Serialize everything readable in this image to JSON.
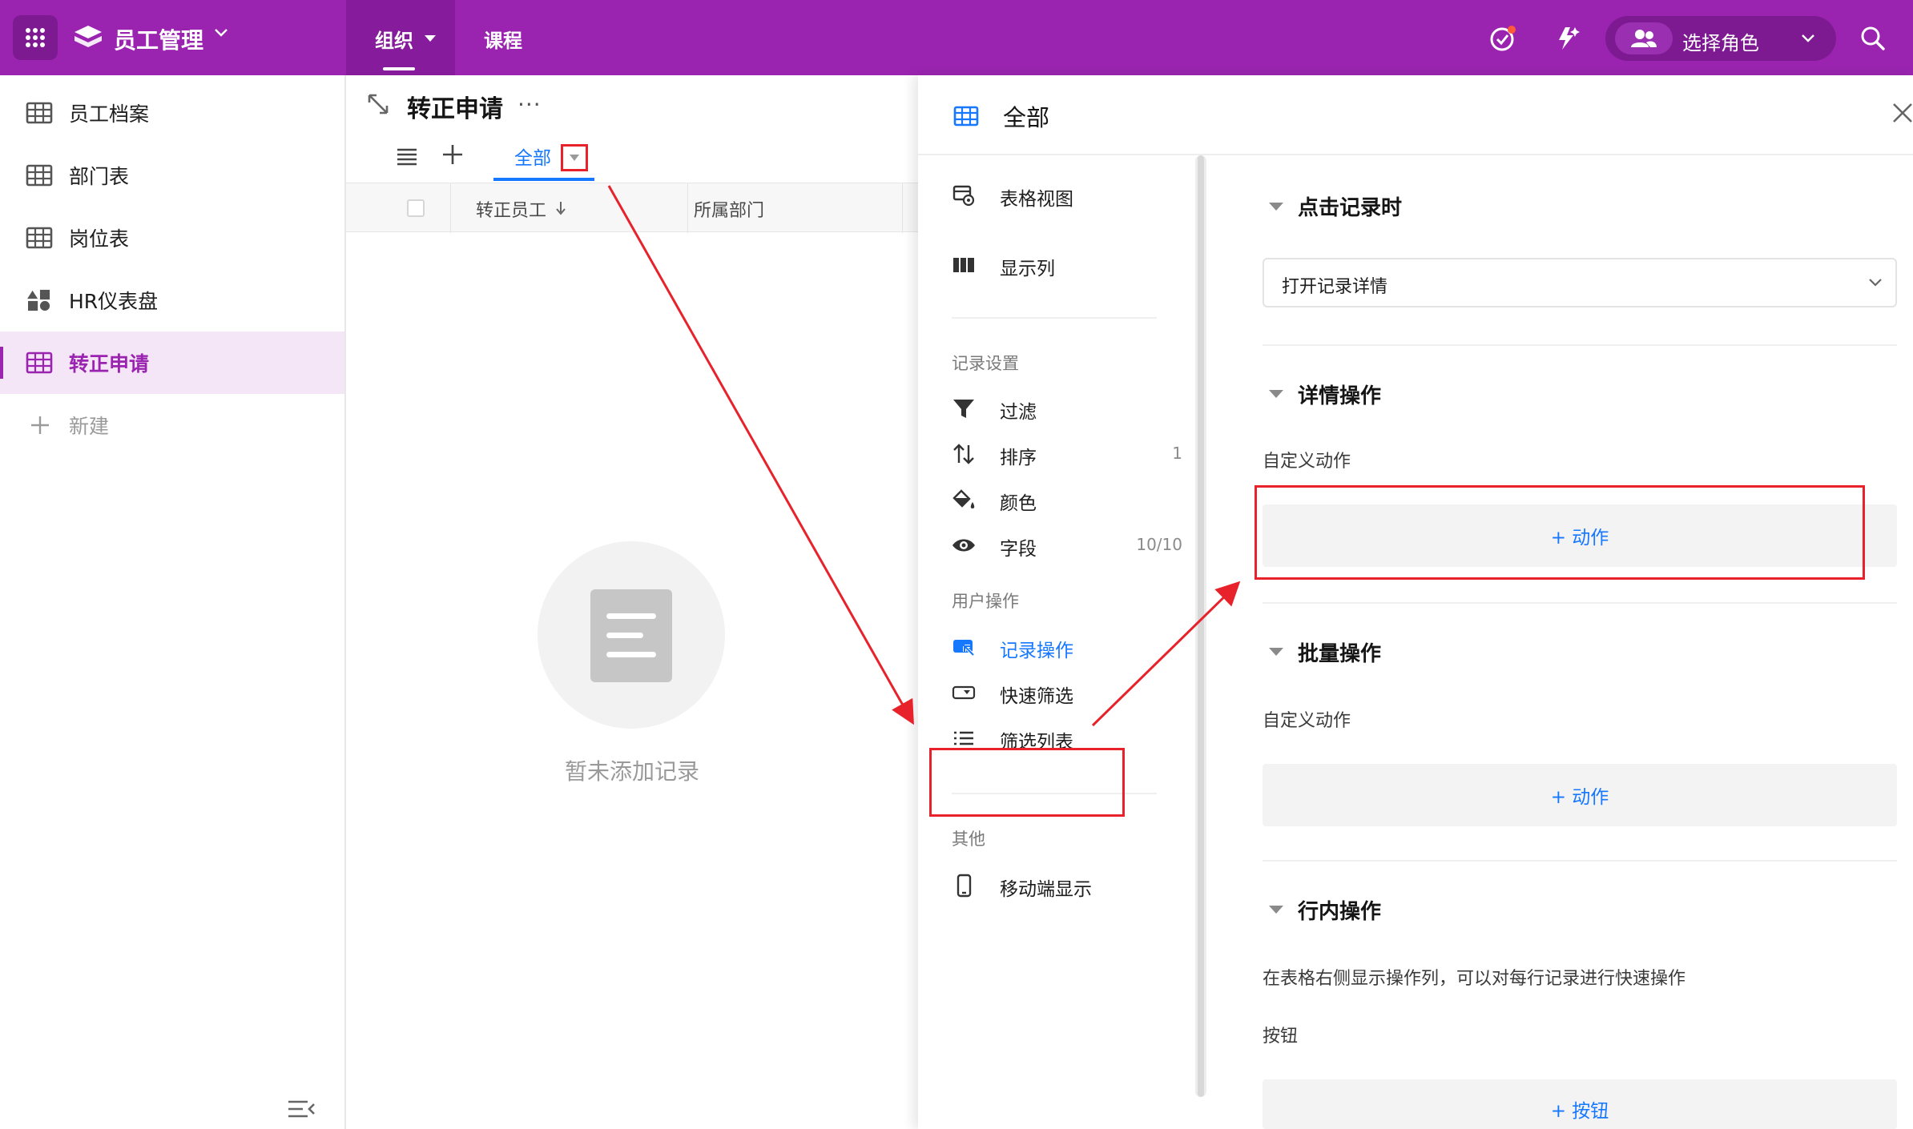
{
  "topbar": {
    "app_name": "员工管理",
    "nav": [
      {
        "label": "组织",
        "active": true
      },
      {
        "label": "课程",
        "active": false
      }
    ],
    "role_label": "选择角色",
    "colors": {
      "bar": "#9a24b0",
      "active": "#861c9c"
    },
    "icons": [
      "apps-grid-icon",
      "app-logo-icon",
      "todo-check-icon",
      "ai-spark-icon",
      "users-icon",
      "search-icon"
    ]
  },
  "sidebar": {
    "items": [
      {
        "label": "员工档案",
        "icon": "table-icon",
        "active": false
      },
      {
        "label": "部门表",
        "icon": "table-icon",
        "active": false
      },
      {
        "label": "岗位表",
        "icon": "table-icon",
        "active": false
      },
      {
        "label": "HR仪表盘",
        "icon": "dashboard-icon",
        "active": false
      },
      {
        "label": "转正申请",
        "icon": "table-icon",
        "active": true
      }
    ],
    "new_label": "新建"
  },
  "worksheet": {
    "title": "转正申请",
    "more": "···",
    "view_tab": "全部",
    "columns": [
      "转正员工",
      "所属部门"
    ],
    "empty_text": "暂未添加记录"
  },
  "panel": {
    "title": "全部",
    "nav": {
      "top_items": [
        {
          "label": "表格视图",
          "icon": "view-icon"
        },
        {
          "label": "显示列",
          "icon": "columns-icon"
        }
      ],
      "record_section": "记录设置",
      "record_items": [
        {
          "label": "过滤",
          "icon": "filter-icon",
          "count": ""
        },
        {
          "label": "排序",
          "icon": "sort-icon",
          "count": "1"
        },
        {
          "label": "颜色",
          "icon": "paint-bucket-icon",
          "count": ""
        },
        {
          "label": "字段",
          "icon": "eye-icon",
          "count": "10/10"
        }
      ],
      "user_section": "用户操作",
      "user_items": [
        {
          "label": "记录操作",
          "icon": "record-action-icon",
          "active": true
        },
        {
          "label": "快速筛选",
          "icon": "quick-filter-icon",
          "active": false
        },
        {
          "label": "筛选列表",
          "icon": "list-icon",
          "active": false
        }
      ],
      "other_section": "其他",
      "other_items": [
        {
          "label": "移动端显示",
          "icon": "mobile-icon"
        }
      ]
    },
    "content": {
      "click_record": {
        "title": "点击记录时",
        "select_value": "打开记录详情"
      },
      "detail_actions": {
        "title": "详情操作",
        "sub": "自定义动作",
        "add_label": "+ 动作"
      },
      "batch_actions": {
        "title": "批量操作",
        "sub": "自定义动作",
        "add_label": "+ 动作"
      },
      "inline_actions": {
        "title": "行内操作",
        "desc": "在表格右侧显示操作列，可以对每行记录进行快速操作",
        "sub": "按钮",
        "add_label": "+ 按钮"
      }
    }
  },
  "colors": {
    "accent": "#1677ff",
    "brand": "#9a24b0",
    "annotation": "#e8222a"
  }
}
